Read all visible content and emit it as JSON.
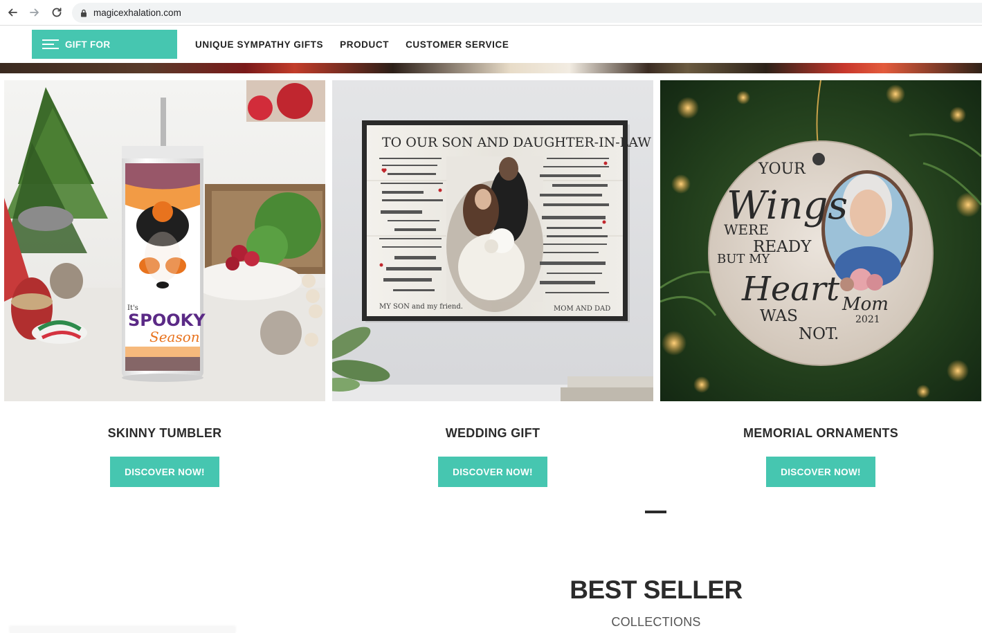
{
  "browser": {
    "url": "magicexhalation.com"
  },
  "header": {
    "menu_button_label": "GIFT FOR",
    "nav": [
      "UNIQUE SYMPATHY GIFTS",
      "PRODUCT",
      "CUSTOMER SERVICE"
    ]
  },
  "products": [
    {
      "title": "SKINNY TUMBLER",
      "button": "DISCOVER NOW!",
      "tumbler_text_1": "It's",
      "tumbler_text_2": "SPOOKY",
      "tumbler_text_3": "Season"
    },
    {
      "title": "WEDDING GIFT",
      "button": "DISCOVER NOW!",
      "poster_title": "TO OUR SON AND DAUGHTER-IN-LAW",
      "poster_sign": "MOM AND DAD",
      "poster_left": "MY SON and my friend."
    },
    {
      "title": "MEMORIAL ORNAMENTS",
      "button": "DISCOVER NOW!",
      "orn_1": "YOUR",
      "orn_2": "Wings",
      "orn_3": "WERE",
      "orn_4": "READY",
      "orn_5": "BUT MY",
      "orn_6": "Heart",
      "orn_7": "WAS",
      "orn_8": "NOT.",
      "orn_9": "Mom",
      "orn_10": "2021"
    }
  ],
  "best_seller": {
    "title": "BEST SELLER",
    "subtitle": "COLLECTIONS"
  },
  "colors": {
    "accent": "#46c6b0",
    "text": "#2b2b2b"
  }
}
